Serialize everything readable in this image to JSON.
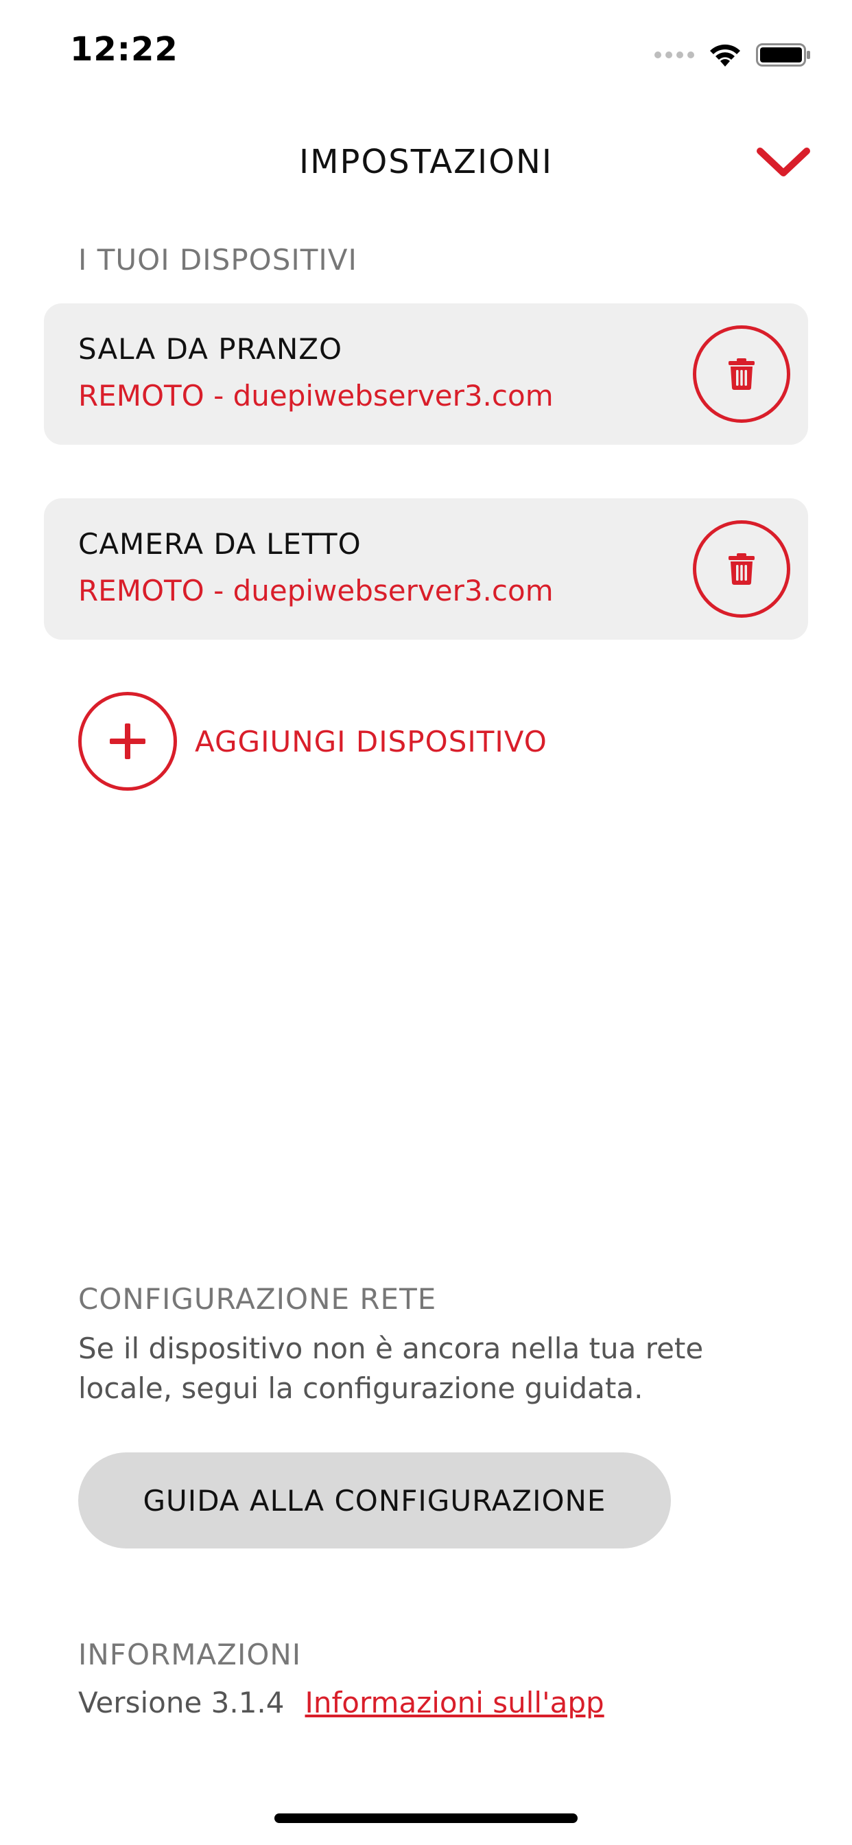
{
  "status_bar": {
    "time": "12:22",
    "icons": [
      "signal-dots-icon",
      "wifi-icon",
      "battery-icon"
    ]
  },
  "header": {
    "title": "IMPOSTAZIONI",
    "close_icon": "chevron-down-icon"
  },
  "devices_section": {
    "label": "I TUOI DISPOSITIVI",
    "devices": [
      {
        "name": "SALA DA PRANZO",
        "address": "REMOTO - duepiwebserver3.com"
      },
      {
        "name": "CAMERA DA LETTO",
        "address": "REMOTO - duepiwebserver3.com"
      }
    ],
    "add_label": "AGGIUNGI DISPOSITIVO"
  },
  "network_section": {
    "label": "CONFIGURAZIONE RETE",
    "description": "Se il dispositivo non è ancora nella tua rete locale, segui la configurazione guidata.",
    "button_label": "GUIDA ALLA CONFIGURAZIONE"
  },
  "info_section": {
    "label": "INFORMAZIONI",
    "version": "Versione 3.1.4",
    "link_label": "Informazioni sull'app"
  },
  "colors": {
    "accent": "#d91e2a",
    "card_bg": "#efefef",
    "button_bg": "#d9d9d9",
    "muted_text": "#777777"
  }
}
